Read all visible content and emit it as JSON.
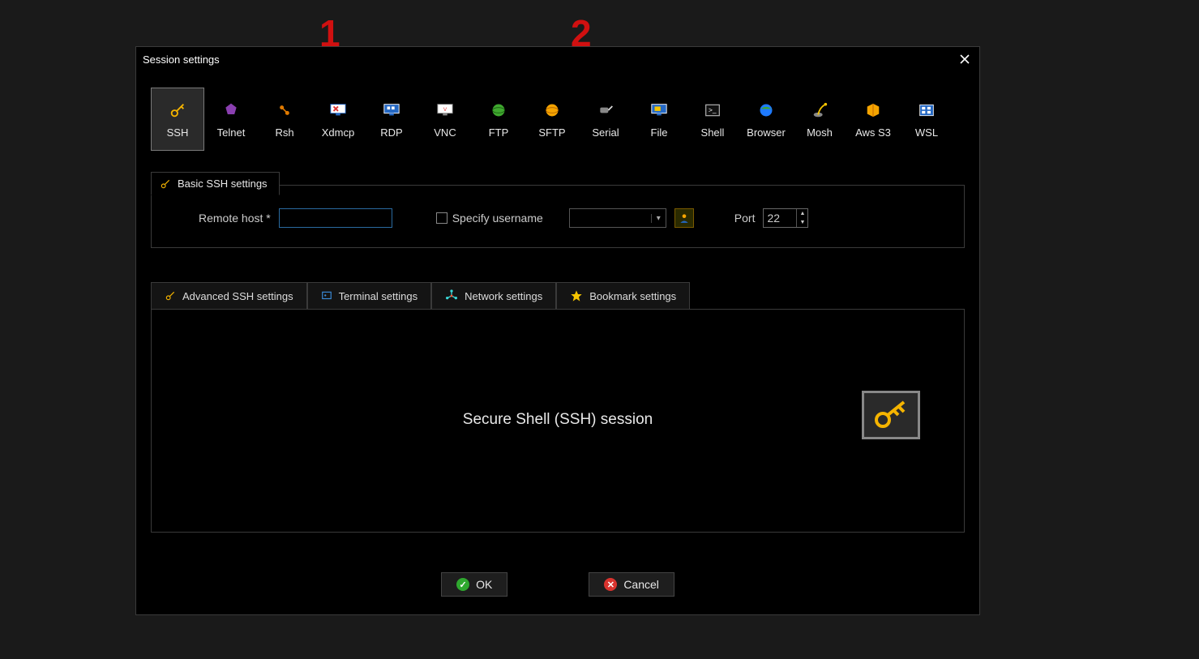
{
  "annotations": {
    "num1": "1",
    "num2": "2"
  },
  "dialog": {
    "title": "Session settings"
  },
  "session_types": {
    "ssh": {
      "label": "SSH"
    },
    "telnet": {
      "label": "Telnet"
    },
    "rsh": {
      "label": "Rsh"
    },
    "xdmcp": {
      "label": "Xdmcp"
    },
    "rdp": {
      "label": "RDP"
    },
    "vnc": {
      "label": "VNC"
    },
    "ftp": {
      "label": "FTP"
    },
    "sftp": {
      "label": "SFTP"
    },
    "serial": {
      "label": "Serial"
    },
    "file": {
      "label": "File"
    },
    "shell": {
      "label": "Shell"
    },
    "browser": {
      "label": "Browser"
    },
    "mosh": {
      "label": "Mosh"
    },
    "awss3": {
      "label": "Aws S3"
    },
    "wsl": {
      "label": "WSL"
    }
  },
  "basic": {
    "group_title": "Basic SSH settings",
    "remote_host_label": "Remote host *",
    "remote_host_value": "",
    "specify_user_label": "Specify username",
    "username_value": "",
    "port_label": "Port",
    "port_value": "22"
  },
  "tabs": {
    "advanced": "Advanced SSH settings",
    "terminal": "Terminal settings",
    "network": "Network settings",
    "bookmark": "Bookmark settings"
  },
  "panel": {
    "text": "Secure Shell (SSH) session"
  },
  "buttons": {
    "ok": "OK",
    "cancel": "Cancel"
  }
}
